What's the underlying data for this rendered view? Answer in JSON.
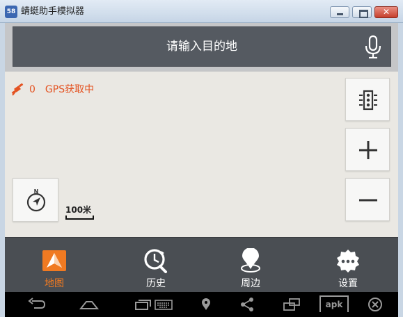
{
  "window": {
    "title": "蜻蜓助手模拟器",
    "logo_text": "58",
    "close_glyph": "✕"
  },
  "search": {
    "placeholder": "请输入目的地",
    "icon": "microphone-icon"
  },
  "gps": {
    "satellite_count": "0",
    "status": "GPS获取中",
    "icon": "satellite-icon"
  },
  "map_controls": {
    "traffic_icon": "traffic-light-icon",
    "zoom_in_icon": "plus-icon",
    "zoom_out_icon": "minus-icon",
    "compass_icon": "compass-icon",
    "scale": "100米"
  },
  "tabs": [
    {
      "label": "地图",
      "icon": "map-arrow-icon",
      "active": true
    },
    {
      "label": "历史",
      "icon": "history-icon",
      "active": false
    },
    {
      "label": "周边",
      "icon": "location-pin-icon",
      "active": false
    },
    {
      "label": "设置",
      "icon": "settings-gear-icon",
      "active": false
    }
  ],
  "navbar": {
    "apk_label": "apk"
  },
  "colors": {
    "accent": "#f07a22",
    "gps_text": "#e45322",
    "search_bar": "#555a61",
    "tabbar": "#4a4e53",
    "map_background": "#eae8e3"
  }
}
